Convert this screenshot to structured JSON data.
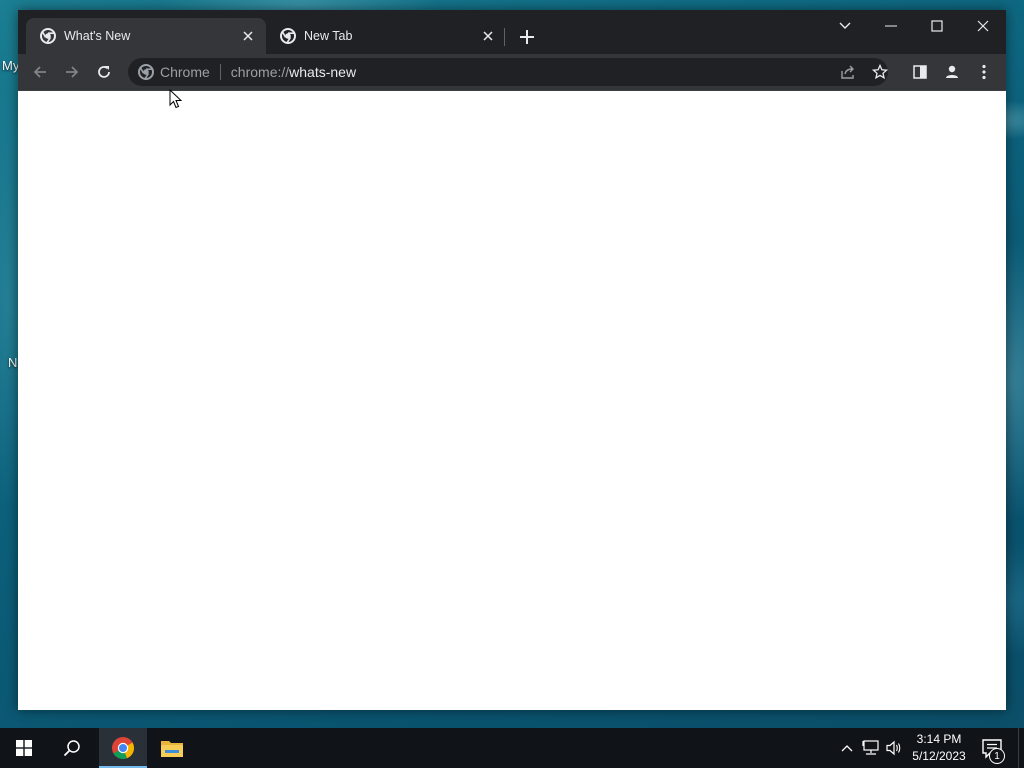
{
  "desktop": {
    "icon_labels": [
      "My",
      "N"
    ]
  },
  "browser": {
    "tabs": [
      {
        "title": "What's New",
        "active": true
      },
      {
        "title": "New Tab",
        "active": false
      }
    ],
    "omnibox": {
      "chip": "Chrome",
      "url_scheme": "chrome://",
      "url_path": "whats-new"
    },
    "colors": {
      "tabstrip": "#202124",
      "toolbar": "#35363a",
      "omnibox": "#202124",
      "content": "#ffffff"
    },
    "icons": [
      "chrome-icon",
      "close-icon",
      "plus-icon",
      "chevron-down-icon",
      "minimize-icon",
      "maximize-icon",
      "back-icon",
      "forward-icon",
      "reload-icon",
      "share-icon",
      "star-icon",
      "side-panel-icon",
      "profile-icon",
      "menu-icon"
    ]
  },
  "taskbar": {
    "clock": {
      "time": "3:14 PM",
      "date": "5/12/2023"
    },
    "notification_count": "1",
    "accent": "#76b9ed"
  }
}
